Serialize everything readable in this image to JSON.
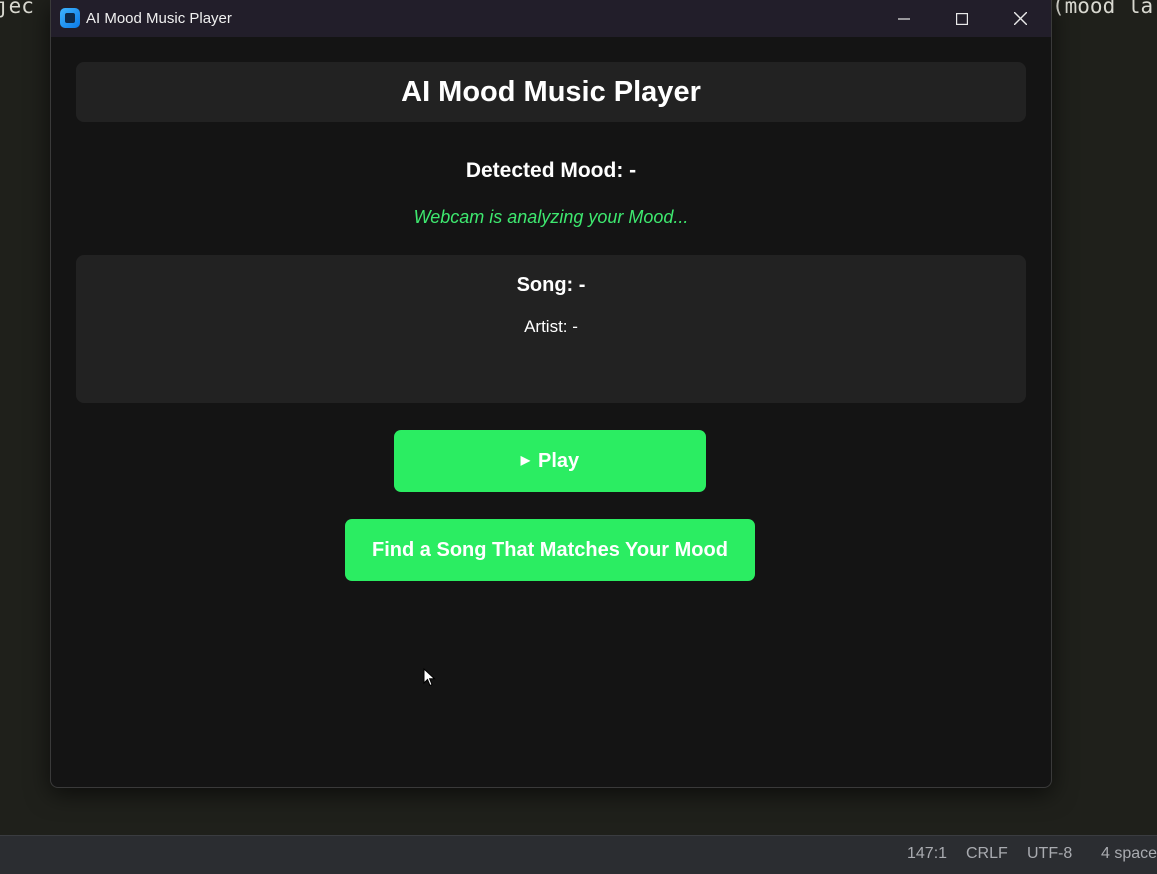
{
  "background": {
    "code_left": "jec",
    "code_right": "(mood la"
  },
  "statusbar": {
    "position": "147:1",
    "line_ending": "CRLF",
    "encoding": "UTF-8",
    "indent": "4 space"
  },
  "window": {
    "title": "AI Mood Music Player"
  },
  "app": {
    "header_title": "AI Mood Music Player",
    "detected_mood_label": "Detected Mood: -",
    "status_text": "Webcam is analyzing your Mood...",
    "song_label": "Song: -",
    "artist_label": "Artist: -",
    "play_icon": "▶",
    "play_button_label": "Play",
    "find_button_label": "Find a Song That Matches Your Mood"
  },
  "colors": {
    "accent_green": "#2bed62",
    "status_green": "#3ee86f",
    "card_bg": "#222222",
    "window_bg": "#141414"
  }
}
